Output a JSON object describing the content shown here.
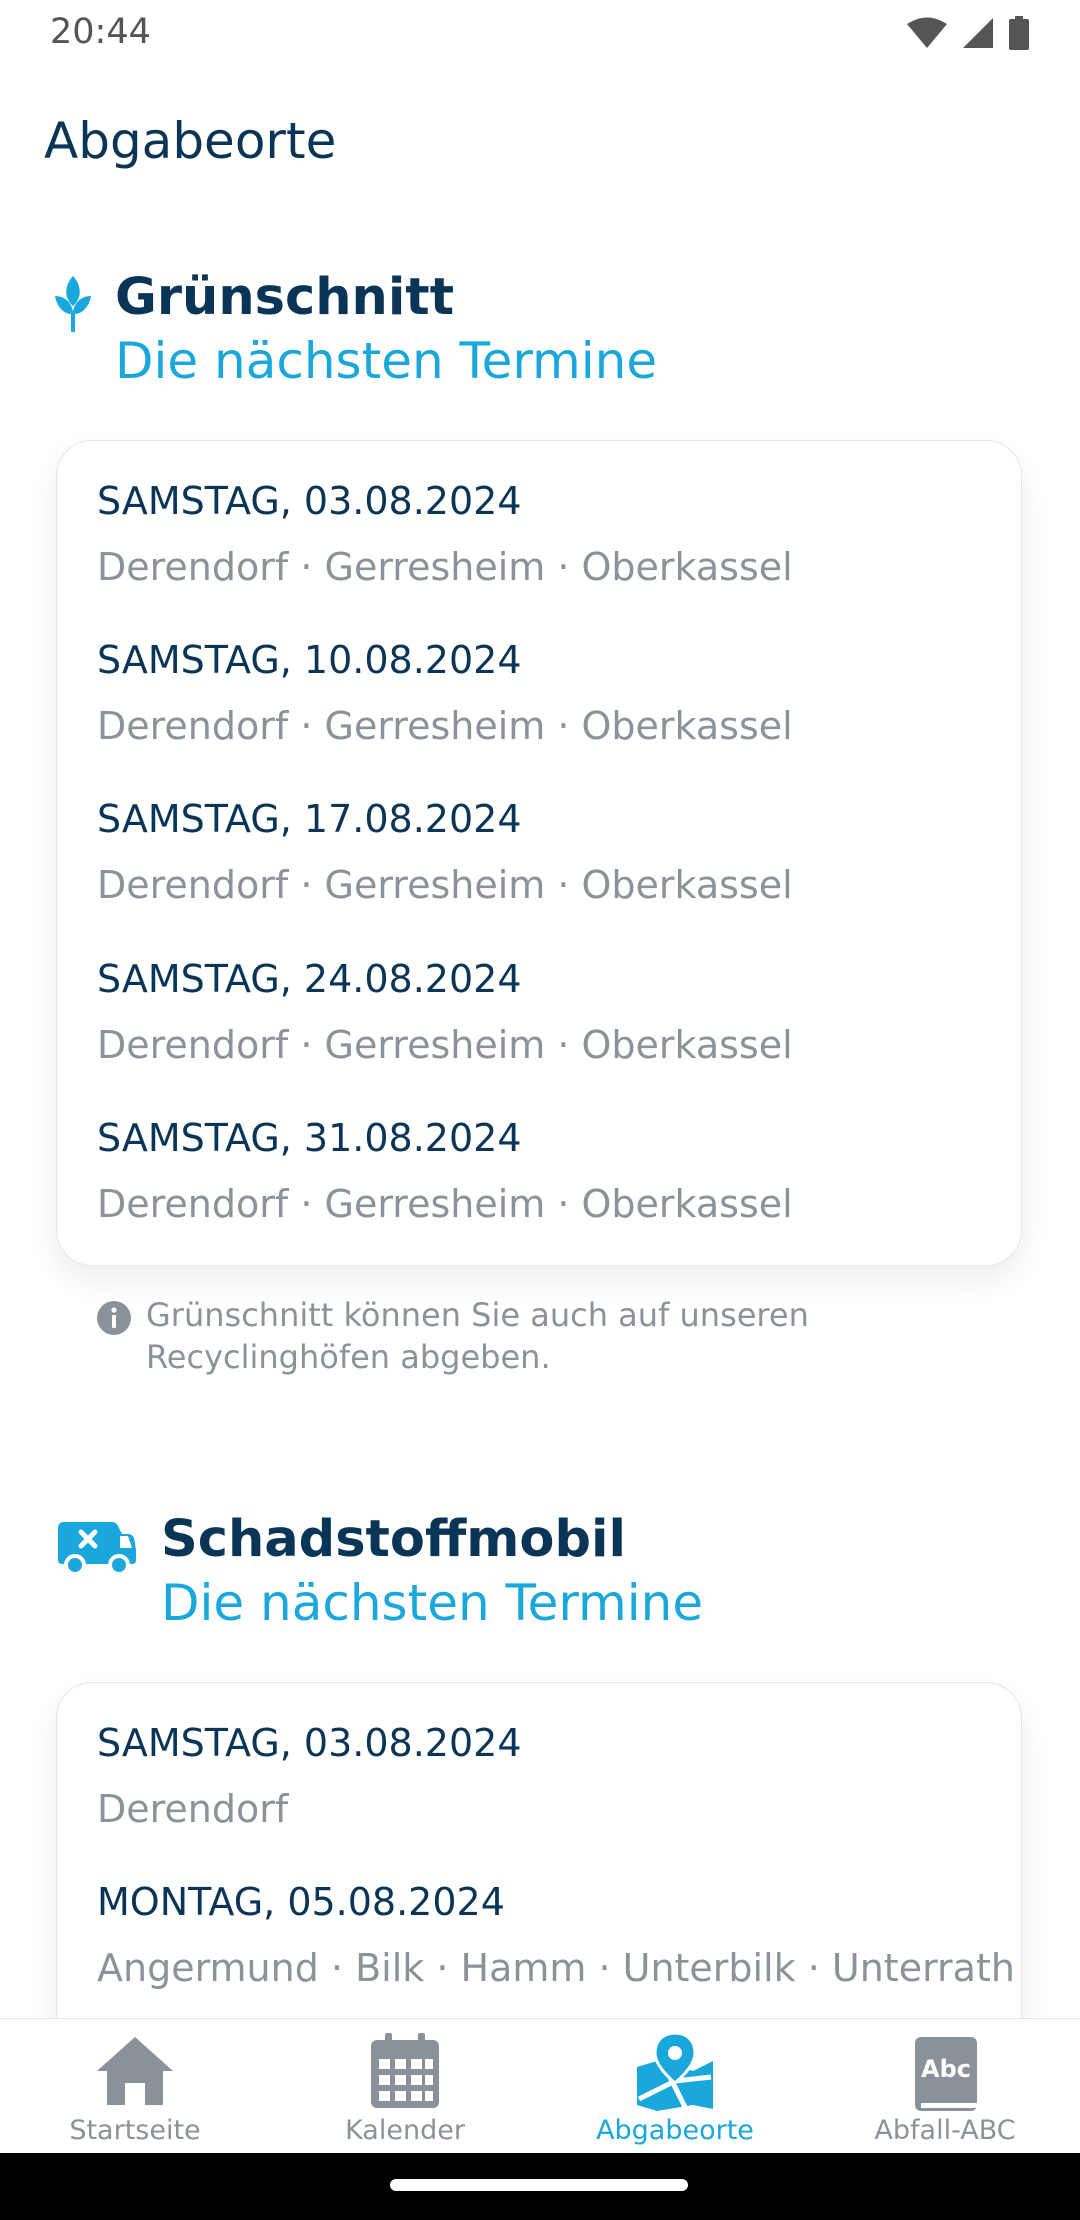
{
  "status": {
    "time": "20:44"
  },
  "header": {
    "title": "Abgabeorte"
  },
  "sections": [
    {
      "title": "Grünschnitt",
      "subtitle": "Die nächsten Termine",
      "icon": "leaf-icon",
      "entries": [
        {
          "date": "SAMSTAG, 03.08.2024",
          "places": "Derendorf · Gerresheim · Oberkassel"
        },
        {
          "date": "SAMSTAG, 10.08.2024",
          "places": "Derendorf · Gerresheim · Oberkassel"
        },
        {
          "date": "SAMSTAG, 17.08.2024",
          "places": "Derendorf · Gerresheim · Oberkassel"
        },
        {
          "date": "SAMSTAG, 24.08.2024",
          "places": "Derendorf · Gerresheim · Oberkassel"
        },
        {
          "date": "SAMSTAG, 31.08.2024",
          "places": "Derendorf · Gerresheim · Oberkassel"
        }
      ],
      "hint": "Grünschnitt können Sie auch auf unseren Recyclinghöfen abgeben."
    },
    {
      "title": "Schadstoffmobil",
      "subtitle": "Die nächsten Termine",
      "icon": "truck-icon",
      "entries": [
        {
          "date": "SAMSTAG, 03.08.2024",
          "places": "Derendorf"
        },
        {
          "date": "MONTAG, 05.08.2024",
          "places": "Angermund · Bilk · Hamm · Unterbilk · Unterrath"
        }
      ]
    }
  ],
  "nav": {
    "items": [
      {
        "label": "Startseite",
        "icon": "home-icon"
      },
      {
        "label": "Kalender",
        "icon": "calendar-icon"
      },
      {
        "label": "Abgabeorte",
        "icon": "map-pin-icon",
        "active": true
      },
      {
        "label": "Abfall-ABC",
        "icon": "abc-book-icon",
        "icon_text": "Abc"
      }
    ]
  },
  "colors": {
    "primary_dark": "#0b3556",
    "accent": "#1aa7dc",
    "muted": "#8c9298",
    "icon_gray": "#8a9198"
  }
}
